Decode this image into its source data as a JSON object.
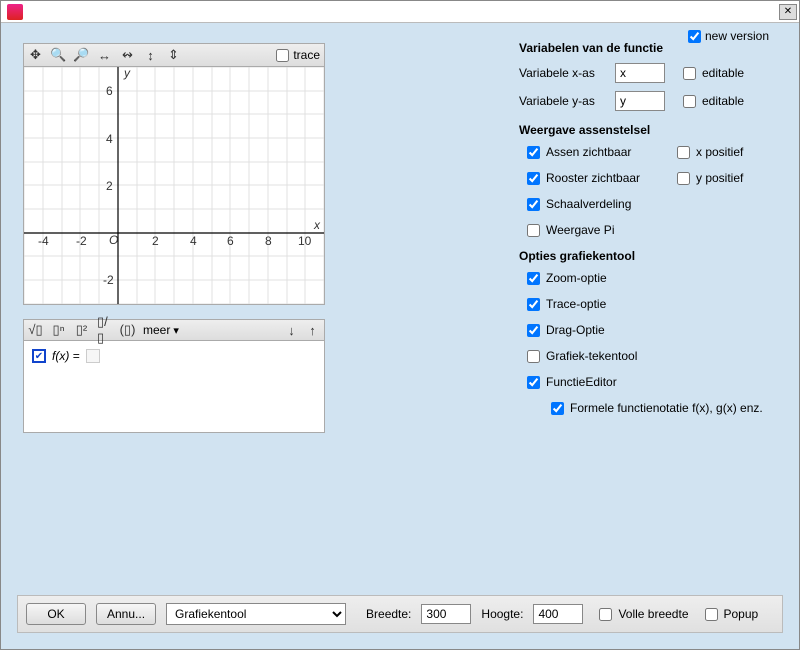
{
  "titlebar": {
    "close": "✕"
  },
  "new_version": {
    "checked": true,
    "label": "new version"
  },
  "toolbar": {
    "trace_label": "trace",
    "trace_checked": false
  },
  "chart_data": {
    "type": "line",
    "x_range": [
      -5,
      11
    ],
    "y_range": [
      -3,
      7
    ],
    "xlabel": "x",
    "ylabel": "y",
    "origin_label": "O",
    "x_ticks": [
      -4,
      -2,
      2,
      4,
      6,
      8,
      10
    ],
    "y_ticks": [
      -2,
      2,
      4,
      6
    ],
    "grid": true,
    "series": []
  },
  "formula_toolbar": {
    "items": [
      "√▯",
      "▯ⁿ",
      "▯²",
      "▯/▯",
      "(▯)"
    ],
    "meer": "meer"
  },
  "formula": {
    "expr": "f(x) =",
    "checked": true
  },
  "sections": {
    "var_title": "Variabelen van de functie",
    "var_x_label": "Variabele x-as",
    "var_x_value": "x",
    "var_y_label": "Variabele y-as",
    "var_y_value": "y",
    "editable_label": "editable",
    "var_x_editable": false,
    "var_y_editable": false,
    "axes_title": "Weergave assenstelsel",
    "axes": {
      "assen": {
        "label": "Assen zichtbaar",
        "checked": true
      },
      "xpos": {
        "label": "x positief",
        "checked": false
      },
      "rooster": {
        "label": "Rooster zichtbaar",
        "checked": true
      },
      "ypos": {
        "label": "y positief",
        "checked": false
      },
      "schaal": {
        "label": "Schaalverdeling",
        "checked": true
      },
      "pi": {
        "label": "Weergave Pi",
        "checked": false
      }
    },
    "opt_title": "Opties grafiekentool",
    "opts": {
      "zoom": {
        "label": "Zoom-optie",
        "checked": true
      },
      "trace": {
        "label": "Trace-optie",
        "checked": true
      },
      "drag": {
        "label": "Drag-Optie",
        "checked": true
      },
      "draw": {
        "label": "Grafiek-tekentool",
        "checked": false
      },
      "func": {
        "label": "FunctieEditor",
        "checked": true
      },
      "formal": {
        "label": "Formele functienotatie f(x), g(x) enz.",
        "checked": true
      }
    }
  },
  "bottom": {
    "ok": "OK",
    "cancel": "Annu...",
    "dropdown_selected": "Grafiekentool",
    "breedte_label": "Breedte:",
    "breedte_value": "300",
    "hoogte_label": "Hoogte:",
    "hoogte_value": "400",
    "volle_label": "Volle breedte",
    "volle_checked": false,
    "popup_label": "Popup",
    "popup_checked": false
  }
}
